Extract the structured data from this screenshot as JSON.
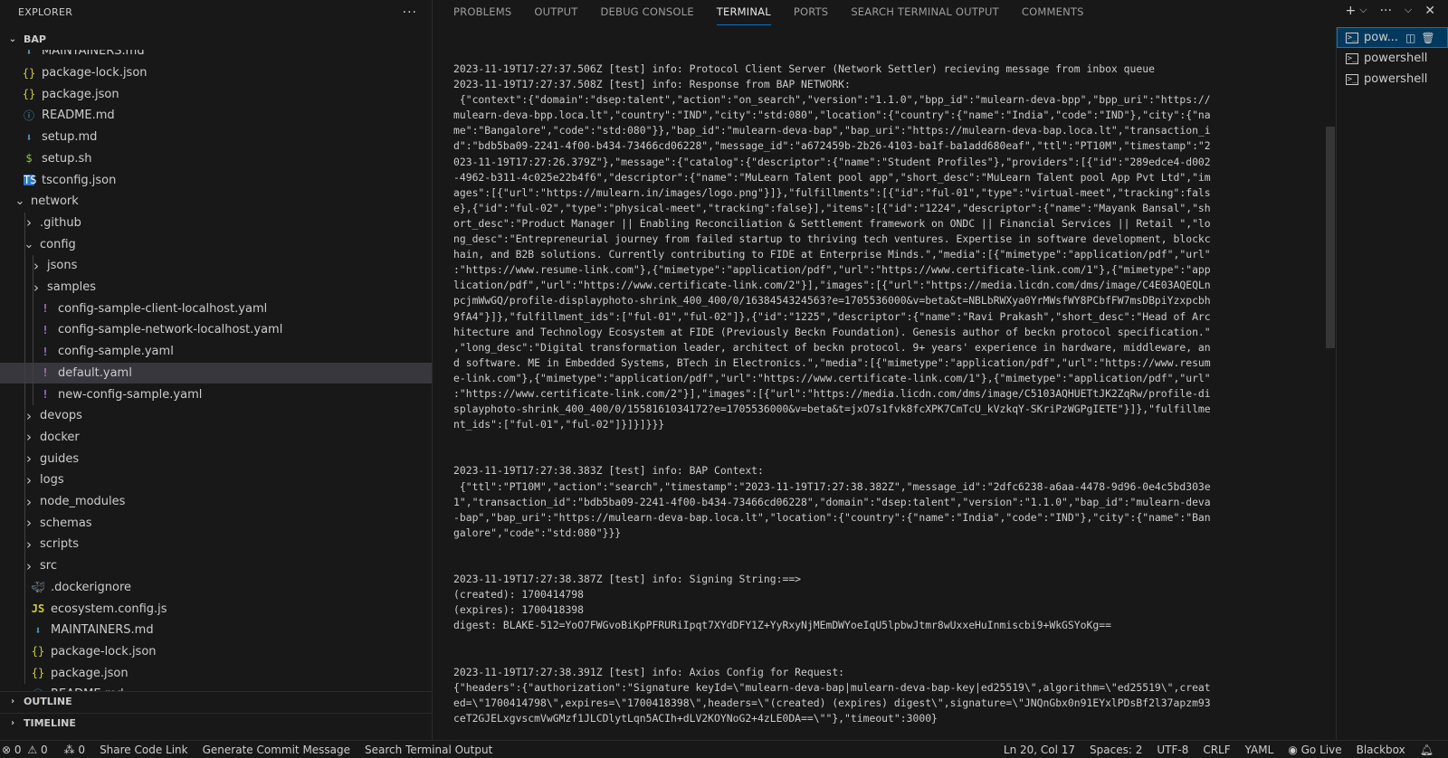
{
  "sidebar": {
    "header": "EXPLORER",
    "more": "···",
    "root": "BAP",
    "outline": "OUTLINE",
    "timeline": "TIMELINE",
    "tree": [
      {
        "label": "MAINTAINERS.md",
        "icon": "md",
        "depth": 1,
        "partial": "top"
      },
      {
        "label": "package-lock.json",
        "icon": "json",
        "depth": 1
      },
      {
        "label": "package.json",
        "icon": "json",
        "depth": 1
      },
      {
        "label": "README.md",
        "icon": "info",
        "depth": 1
      },
      {
        "label": "setup.md",
        "icon": "md",
        "depth": 1
      },
      {
        "label": "setup.sh",
        "icon": "sh",
        "depth": 1
      },
      {
        "label": "tsconfig.json",
        "icon": "ts",
        "depth": 1
      },
      {
        "label": "network",
        "icon": "folder-open",
        "depth": 1
      },
      {
        "label": ".github",
        "icon": "folder",
        "depth": 2
      },
      {
        "label": "config",
        "icon": "folder-open",
        "depth": 2
      },
      {
        "label": "jsons",
        "icon": "folder",
        "depth": 3
      },
      {
        "label": "samples",
        "icon": "folder",
        "depth": 3
      },
      {
        "label": "config-sample-client-localhost.yaml",
        "icon": "yaml",
        "depth": 3
      },
      {
        "label": "config-sample-network-localhost.yaml",
        "icon": "yaml",
        "depth": 3
      },
      {
        "label": "config-sample.yaml",
        "icon": "yaml",
        "depth": 3
      },
      {
        "label": "default.yaml",
        "icon": "yaml",
        "depth": 3,
        "selected": true
      },
      {
        "label": "new-config-sample.yaml",
        "icon": "yaml",
        "depth": 3
      },
      {
        "label": "devops",
        "icon": "folder",
        "depth": 2
      },
      {
        "label": "docker",
        "icon": "folder",
        "depth": 2
      },
      {
        "label": "guides",
        "icon": "folder",
        "depth": 2
      },
      {
        "label": "logs",
        "icon": "folder",
        "depth": 2
      },
      {
        "label": "node_modules",
        "icon": "folder",
        "depth": 2
      },
      {
        "label": "schemas",
        "icon": "folder",
        "depth": 2
      },
      {
        "label": "scripts",
        "icon": "folder",
        "depth": 2
      },
      {
        "label": "src",
        "icon": "folder",
        "depth": 2
      },
      {
        "label": ".dockerignore",
        "icon": "docker",
        "depth": 2
      },
      {
        "label": "ecosystem.config.js",
        "icon": "js",
        "depth": 2
      },
      {
        "label": "MAINTAINERS.md",
        "icon": "md",
        "depth": 2
      },
      {
        "label": "package-lock.json",
        "icon": "json",
        "depth": 2
      },
      {
        "label": "package.json",
        "icon": "json",
        "depth": 2
      },
      {
        "label": "README.md",
        "icon": "info",
        "depth": 2,
        "partial": "bottom"
      }
    ]
  },
  "panel": {
    "tabs": [
      {
        "label": "PROBLEMS"
      },
      {
        "label": "OUTPUT"
      },
      {
        "label": "DEBUG CONSOLE"
      },
      {
        "label": "TERMINAL",
        "active": true
      },
      {
        "label": "PORTS"
      },
      {
        "label": "SEARCH TERMINAL OUTPUT"
      },
      {
        "label": "COMMENTS"
      }
    ],
    "actions": {
      "new": "+",
      "dropdown": "⌵",
      "more": "···",
      "collapse": "⌵",
      "close": "✕"
    },
    "terminals": [
      {
        "label": "pow...",
        "active": true
      },
      {
        "label": "powershell"
      },
      {
        "label": "powershell"
      }
    ],
    "terminal_lines": [
      "2023-11-19T17:27:37.506Z [test] info: Protocol Client Server (Network Settler) recieving message from inbox queue",
      "2023-11-19T17:27:37.508Z [test] info: Response from BAP NETWORK:",
      " {\"context\":{\"domain\":\"dsep:talent\",\"action\":\"on_search\",\"version\":\"1.1.0\",\"bpp_id\":\"mulearn-deva-bpp\",\"bpp_uri\":\"https://",
      "mulearn-deva-bpp.loca.lt\",\"country\":\"IND\",\"city\":\"std:080\",\"location\":{\"country\":{\"name\":\"India\",\"code\":\"IND\"},\"city\":{\"na",
      "me\":\"Bangalore\",\"code\":\"std:080\"}},\"bap_id\":\"mulearn-deva-bap\",\"bap_uri\":\"https://mulearn-deva-bap.loca.lt\",\"transaction_i",
      "d\":\"bdb5ba09-2241-4f00-b434-73466cd06228\",\"message_id\":\"a672459b-2b26-4103-ba1f-ba1add680eaf\",\"ttl\":\"PT10M\",\"timestamp\":\"2",
      "023-11-19T17:27:26.379Z\"},\"message\":{\"catalog\":{\"descriptor\":{\"name\":\"Student Profiles\"},\"providers\":[{\"id\":\"289edce4-d002",
      "-4962-b311-4c025e22b4f6\",\"descriptor\":{\"name\":\"MuLearn Talent pool app\",\"short_desc\":\"MuLearn Talent pool App Pvt Ltd\",\"im",
      "ages\":[{\"url\":\"https://mulearn.in/images/logo.png\"}]},\"fulfillments\":[{\"id\":\"ful-01\",\"type\":\"virtual-meet\",\"tracking\":fals",
      "e},{\"id\":\"ful-02\",\"type\":\"physical-meet\",\"tracking\":false}],\"items\":[{\"id\":\"1224\",\"descriptor\":{\"name\":\"Mayank Bansal\",\"sh",
      "ort_desc\":\"Product Manager || Enabling Reconciliation & Settlement framework on ONDC || Financial Services || Retail \",\"lo",
      "ng_desc\":\"Entrepreneurial journey from failed startup to thriving tech ventures. Expertise in software development, blockc",
      "hain, and B2B solutions. Currently contributing to FIDE at Enterprise Minds.\",\"media\":[{\"mimetype\":\"application/pdf\",\"url\"",
      ":\"https://www.resume-link.com\"},{\"mimetype\":\"application/pdf\",\"url\":\"https://www.certificate-link.com/1\"},{\"mimetype\":\"app",
      "lication/pdf\",\"url\":\"https://www.certificate-link.com/2\"}],\"images\":[{\"url\":\"https://media.licdn.com/dms/image/C4E03AQEQLn",
      "pcjmWwGQ/profile-displayphoto-shrink_400_400/0/1638454324563?e=1705536000&v=beta&t=NBLbRWXya0YrMWsfWY8PCbfFW7msDBpiYzxpcbh",
      "9fA4\"}]},\"fulfillment_ids\":[\"ful-01\",\"ful-02\"]},{\"id\":\"1225\",\"descriptor\":{\"name\":\"Ravi Prakash\",\"short_desc\":\"Head of Arc",
      "hitecture and Technology Ecosystem at FIDE (Previously Beckn Foundation). Genesis author of beckn protocol specification.\"",
      ",\"long_desc\":\"Digital transformation leader, architect of beckn protocol. 9+ years' experience in hardware, middleware, an",
      "d software. ME in Embedded Systems, BTech in Electronics.\",\"media\":[{\"mimetype\":\"application/pdf\",\"url\":\"https://www.resum",
      "e-link.com\"},{\"mimetype\":\"application/pdf\",\"url\":\"https://www.certificate-link.com/1\"},{\"mimetype\":\"application/pdf\",\"url\"",
      ":\"https://www.certificate-link.com/2\"}],\"images\":[{\"url\":\"https://media.licdn.com/dms/image/C5103AQHUETtJK2ZqRw/profile-di",
      "splayphoto-shrink_400_400/0/1558161034172?e=1705536000&v=beta&t=jxO7s1fvk8fcXPK7CmTcU_kVzkqY-SKriPzWGPgIETE\"}]},\"fulfillme",
      "nt_ids\":[\"ful-01\",\"ful-02\"]}]}]}}}",
      "",
      "",
      "2023-11-19T17:27:38.383Z [test] info: BAP Context:",
      " {\"ttl\":\"PT10M\",\"action\":\"search\",\"timestamp\":\"2023-11-19T17:27:38.382Z\",\"message_id\":\"2dfc6238-a6aa-4478-9d96-0e4c5bd303e",
      "1\",\"transaction_id\":\"bdb5ba09-2241-4f00-b434-73466cd06228\",\"domain\":\"dsep:talent\",\"version\":\"1.1.0\",\"bap_id\":\"mulearn-deva",
      "-bap\",\"bap_uri\":\"https://mulearn-deva-bap.loca.lt\",\"location\":{\"country\":{\"name\":\"India\",\"code\":\"IND\"},\"city\":{\"name\":\"Ban",
      "galore\",\"code\":\"std:080\"}}}",
      "",
      "",
      "2023-11-19T17:27:38.387Z [test] info: Signing String:==>",
      "(created): 1700414798",
      "(expires): 1700418398",
      "digest: BLAKE-512=YoO7FWGvoBiKpPFRURiIpqt7XYdDFY1Z+YyRxyNjMEmDWYoeIqU5lpbwJtmr8wUxxeHuInmiscbi9+WkGSYoKg==",
      "",
      "",
      "2023-11-19T17:27:38.391Z [test] info: Axios Config for Request:",
      "{\"headers\":{\"authorization\":\"Signature keyId=\\\"mulearn-deva-bap|mulearn-deva-bap-key|ed25519\\\",algorithm=\\\"ed25519\\\",creat",
      "ed=\\\"1700414798\\\",expires=\\\"1700418398\\\",headers=\\\"(created) (expires) digest\\\",signature=\\\"JNQnGbx0n91EYxlPDsBf2l37apzm93",
      "ceT2GJELxgvscmVwGMzf1JLCDlytLqn5ACIh+dLV2KOYNoG2+4zLE0DA==\\\"\"},\"timeout\":3000}"
    ]
  },
  "statusbar": {
    "errors": "0",
    "warnings": "0",
    "ports": "0",
    "share": "Share Code Link",
    "commit": "Generate Commit Message",
    "search": "Search Terminal Output",
    "position": "Ln 20, Col 17",
    "spaces": "Spaces: 2",
    "encoding": "UTF-8",
    "eol": "CRLF",
    "language": "YAML",
    "golive": "Go Live",
    "blackbox": "Blackbox"
  }
}
